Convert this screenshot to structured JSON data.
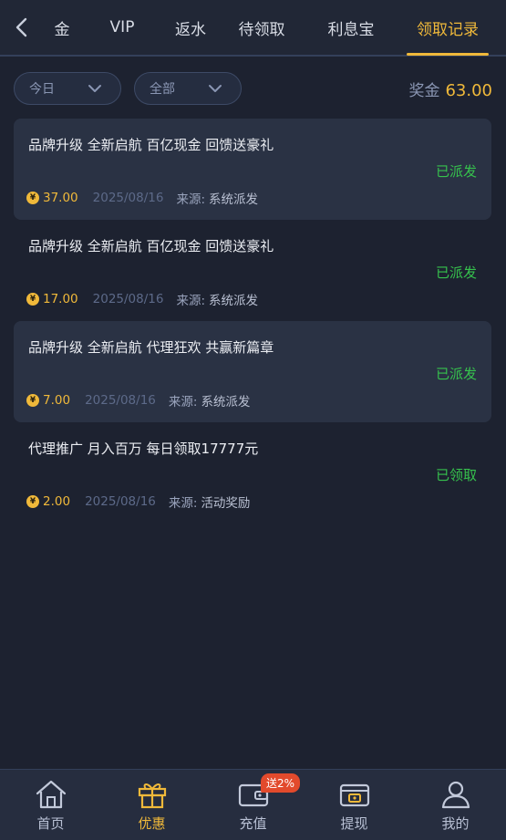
{
  "header": {
    "tabs": [
      {
        "label": "金",
        "active": false
      },
      {
        "label": "VIP",
        "active": false
      },
      {
        "label": "返水",
        "active": false
      },
      {
        "label": "待领取",
        "active": false
      },
      {
        "label": "利息宝",
        "active": false
      },
      {
        "label": "领取记录",
        "active": true
      }
    ]
  },
  "filters": {
    "period": "今日",
    "category": "全部",
    "bonus_label": "奖金",
    "bonus_value": "63.00"
  },
  "records": [
    {
      "title": "品牌升级 全新启航 百亿现金 回馈送豪礼",
      "status": "已派发",
      "amount": "37.00",
      "date": "2025/08/16",
      "source_label": "来源:",
      "source": "系统派发"
    },
    {
      "title": "品牌升级 全新启航 百亿现金 回馈送豪礼",
      "status": "已派发",
      "amount": "17.00",
      "date": "2025/08/16",
      "source_label": "来源:",
      "source": "系统派发"
    },
    {
      "title": "品牌升级 全新启航 代理狂欢 共赢新篇章",
      "status": "已派发",
      "amount": "7.00",
      "date": "2025/08/16",
      "source_label": "来源:",
      "source": "系统派发"
    },
    {
      "title": "代理推广 月入百万 每日领取17777元",
      "status": "已领取",
      "amount": "2.00",
      "date": "2025/08/16",
      "source_label": "来源:",
      "source": "活动奖励"
    }
  ],
  "coin_symbol": "¥",
  "nav": {
    "items": [
      {
        "label": "首页",
        "icon": "home-icon"
      },
      {
        "label": "优惠",
        "icon": "gift-icon"
      },
      {
        "label": "充值",
        "icon": "wallet-icon"
      },
      {
        "label": "提现",
        "icon": "withdraw-icon"
      },
      {
        "label": "我的",
        "icon": "user-icon"
      }
    ],
    "deposit_badge": "送2%"
  },
  "colors": {
    "accent": "#f0b93a",
    "status_green": "#36c24d",
    "background": "#1d2230"
  }
}
